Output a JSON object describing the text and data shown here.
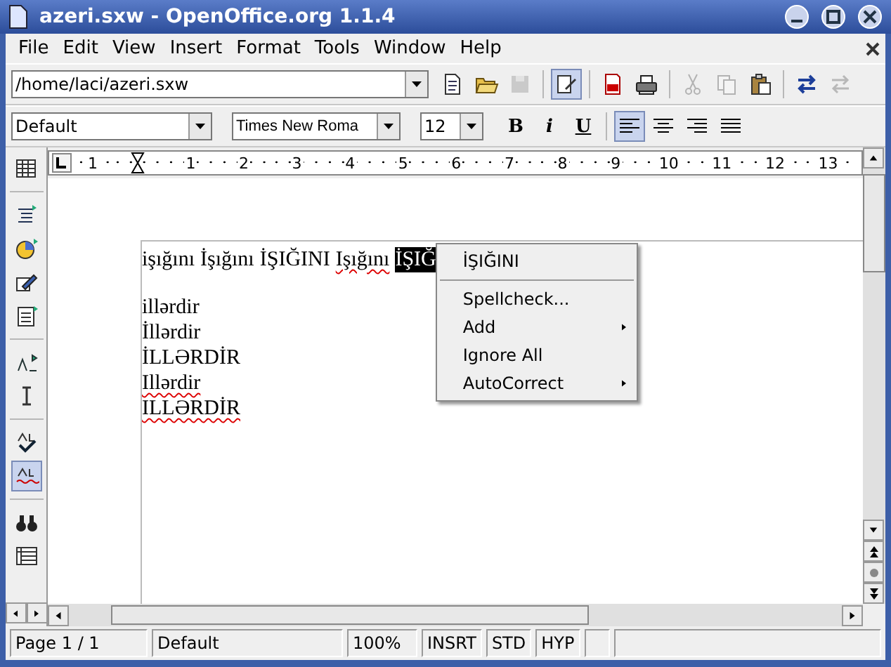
{
  "window": {
    "title": "azeri.sxw - OpenOffice.org 1.1.4"
  },
  "menu": [
    "File",
    "Edit",
    "View",
    "Insert",
    "Format",
    "Tools",
    "Window",
    "Help"
  ],
  "function_bar": {
    "url": "/home/laci/azeri.sxw",
    "tools": [
      {
        "kind": "new",
        "disabled": false,
        "selected": false
      },
      {
        "kind": "open",
        "disabled": false,
        "selected": false
      },
      {
        "kind": "save",
        "disabled": true,
        "selected": false
      },
      {
        "kind": "sep"
      },
      {
        "kind": "edit",
        "disabled": false,
        "selected": true
      },
      {
        "kind": "sep"
      },
      {
        "kind": "pdf",
        "disabled": false,
        "selected": false
      },
      {
        "kind": "print",
        "disabled": false,
        "selected": false
      },
      {
        "kind": "sep"
      },
      {
        "kind": "cut",
        "disabled": true,
        "selected": false
      },
      {
        "kind": "copy",
        "disabled": true,
        "selected": false
      },
      {
        "kind": "paste",
        "disabled": false,
        "selected": false
      },
      {
        "kind": "sep"
      },
      {
        "kind": "undo",
        "disabled": false,
        "selected": false
      },
      {
        "kind": "redo",
        "disabled": true,
        "selected": false
      }
    ]
  },
  "object_bar": {
    "style": "Default",
    "font": "Times New Roma",
    "size": "12",
    "format": [
      {
        "label": "B",
        "kind": "bold",
        "selected": false
      },
      {
        "label": "i",
        "kind": "italic",
        "selected": false
      },
      {
        "label": "U",
        "kind": "underline",
        "selected": false
      }
    ],
    "align": [
      {
        "kind": "left",
        "selected": true
      },
      {
        "kind": "center",
        "selected": false
      },
      {
        "kind": "right",
        "selected": false
      },
      {
        "kind": "justify",
        "selected": false
      }
    ]
  },
  "ruler": [
    "1",
    "1",
    "2",
    "3",
    "4",
    "5",
    "6",
    "7",
    "8",
    "9",
    "10",
    "11",
    "12",
    "13"
  ],
  "main_toolbar": [
    {
      "kind": "table",
      "selected": false
    },
    {
      "kind": "sep"
    },
    {
      "kind": "insert",
      "selected": false
    },
    {
      "kind": "chart",
      "selected": false
    },
    {
      "kind": "draw",
      "selected": false
    },
    {
      "kind": "fields",
      "selected": false
    },
    {
      "kind": "sep"
    },
    {
      "kind": "text",
      "selected": false
    },
    {
      "kind": "cursor",
      "selected": false
    },
    {
      "kind": "sep"
    },
    {
      "kind": "spell",
      "selected": false
    },
    {
      "kind": "autospell",
      "selected": true
    },
    {
      "kind": "sep"
    },
    {
      "kind": "find",
      "selected": false
    },
    {
      "kind": "datasource",
      "selected": false
    }
  ],
  "document": {
    "first_line": [
      {
        "text": "işığını",
        "misspelled": false,
        "selected": false
      },
      {
        "text": "İşığını",
        "misspelled": false,
        "selected": false
      },
      {
        "text": "İŞIĞINI",
        "misspelled": false,
        "selected": false
      },
      {
        "text": "Işığını",
        "misspelled": true,
        "selected": false
      },
      {
        "text": "İŞIĞ",
        "misspelled": false,
        "selected": true
      }
    ],
    "lines": [
      {
        "text": "illərdir",
        "misspelled": false
      },
      {
        "text": "İllərdir",
        "misspelled": false
      },
      {
        "text": "İLLƏRDİR",
        "misspelled": false
      },
      {
        "text": "Illərdir",
        "misspelled": true
      },
      {
        "text": "ILLƏRDİR",
        "misspelled": true
      }
    ]
  },
  "context_menu": [
    {
      "label": "İŞIĞINI",
      "kind": "suggestion",
      "submenu": false
    },
    {
      "label": "Spellcheck...",
      "kind": "item",
      "submenu": false
    },
    {
      "label": "Add",
      "kind": "item",
      "submenu": true
    },
    {
      "label": "Ignore All",
      "kind": "item",
      "submenu": false
    },
    {
      "label": "AutoCorrect",
      "kind": "item",
      "submenu": true
    }
  ],
  "status_bar": [
    "Page 1 / 1",
    "Default",
    "100%",
    "INSRT",
    "STD",
    "HYP"
  ]
}
